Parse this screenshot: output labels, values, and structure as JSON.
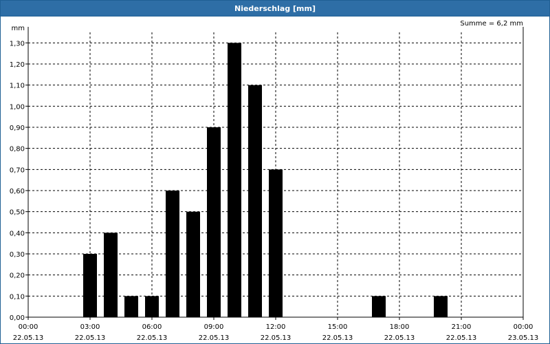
{
  "window": {
    "title": "Niederschlag [mm]"
  },
  "chart_data": {
    "type": "bar",
    "title": "Niederschlag [mm]",
    "ylabel": "mm",
    "annotation": "Summe = 6,2 mm",
    "ylim": [
      0,
      1.35
    ],
    "yticks": [
      "0,00",
      "0,10",
      "0,20",
      "0,30",
      "0,40",
      "0,50",
      "0,60",
      "0,70",
      "0,80",
      "0,90",
      "1,00",
      "1,10",
      "1,20",
      "1,30"
    ],
    "yvalues": [
      0,
      0.1,
      0.2,
      0.3,
      0.4,
      0.5,
      0.6,
      0.7,
      0.8,
      0.9,
      1.0,
      1.1,
      1.2,
      1.3
    ],
    "x_range_hours": [
      0,
      24
    ],
    "xticks": [
      {
        "time": "00:00",
        "date": "22.05.13"
      },
      {
        "time": "03:00",
        "date": "22.05.13"
      },
      {
        "time": "06:00",
        "date": "22.05.13"
      },
      {
        "time": "09:00",
        "date": "22.05.13"
      },
      {
        "time": "12:00",
        "date": "22.05.13"
      },
      {
        "time": "15:00",
        "date": "22.05.13"
      },
      {
        "time": "18:00",
        "date": "22.05.13"
      },
      {
        "time": "21:00",
        "date": "22.05.13"
      },
      {
        "time": "00:00",
        "date": "23.05.13"
      }
    ],
    "bars": [
      {
        "hour": 3,
        "value": 0.3
      },
      {
        "hour": 4,
        "value": 0.4
      },
      {
        "hour": 5,
        "value": 0.1
      },
      {
        "hour": 6,
        "value": 0.1
      },
      {
        "hour": 7,
        "value": 0.6
      },
      {
        "hour": 8,
        "value": 0.5
      },
      {
        "hour": 9,
        "value": 0.9
      },
      {
        "hour": 10,
        "value": 1.3
      },
      {
        "hour": 11,
        "value": 1.1
      },
      {
        "hour": 12,
        "value": 0.7
      },
      {
        "hour": 17,
        "value": 0.1
      },
      {
        "hour": 20,
        "value": 0.1
      }
    ],
    "grid": true,
    "bar_color": "#000000"
  }
}
